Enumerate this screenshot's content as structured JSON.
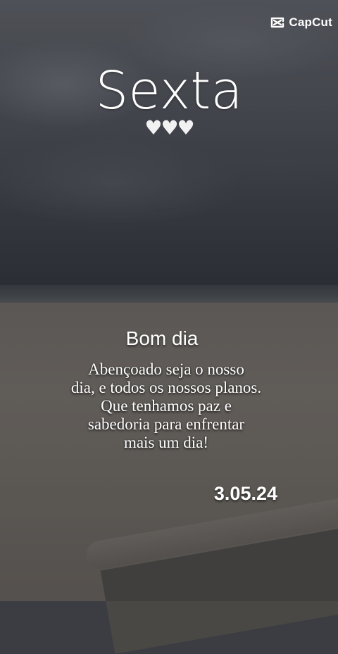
{
  "watermark": {
    "brand": "CapCut",
    "icon": "capcut-logo-icon"
  },
  "title": "Sexta",
  "hearts": "♥♥♥",
  "greeting": "Bom dia",
  "message_lines": [
    "Abençoado seja o nosso",
    "dia, e todos os nossos planos.",
    "Que tenhamos paz e",
    "sabedoria para enfrentar",
    "mais um dia!"
  ],
  "date": "3.05.24",
  "colors": {
    "text": "#ffffff",
    "sky": "#4c4f56",
    "sand": "#6e6a64"
  }
}
